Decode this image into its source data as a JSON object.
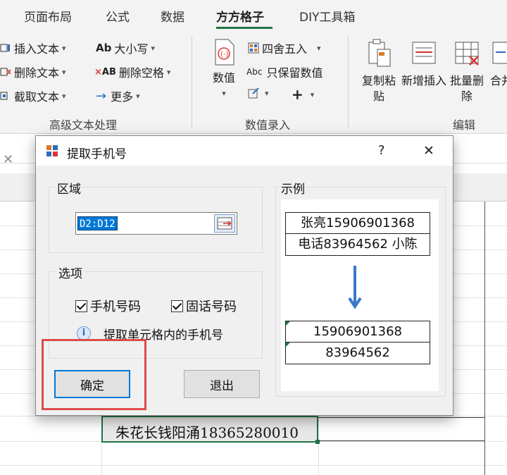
{
  "ribbon": {
    "tabs": [
      "页面布局",
      "公式",
      "数据",
      "方方格子",
      "DIY工具箱"
    ],
    "active_tab": "方方格子",
    "text_group": {
      "items": [
        "插入文本",
        "删除文本",
        "截取文本"
      ],
      "case_label": "大小写",
      "remove_space_label": "删除空格",
      "more_label": "更多",
      "group_label": "高级文本处理"
    },
    "number_group": {
      "value_label": "数值",
      "round_label": "四舍五入",
      "keep_value_label": "只保留数值",
      "group_label": "数值录入"
    },
    "edit_group": {
      "copy_paste_label": "复制粘贴",
      "new_insert_label": "新增插入",
      "batch_delete_label": "批量删除",
      "merge_label": "合并",
      "group_label": "编辑"
    }
  },
  "sheet": {
    "visible_cell_text": "朱花长钱阳涌18365280010"
  },
  "dialog": {
    "title": "提取手机号",
    "help_label": "?",
    "close_label": "✕",
    "region": {
      "label": "区域",
      "value": "D2:D12"
    },
    "options": {
      "label": "选项",
      "mobile_label": "手机号码",
      "mobile_checked": true,
      "landline_label": "固话号码",
      "landline_checked": true,
      "info_text": "提取单元格内的手机号"
    },
    "example": {
      "label": "示例",
      "input_rows": [
        "张亮15906901368",
        "电话83964562 小陈"
      ],
      "output_rows": [
        "15906901368",
        "83964562"
      ]
    },
    "ok_label": "确定",
    "exit_label": "退出"
  },
  "colors": {
    "accent_green": "#217346",
    "highlight_red": "#e04a4a",
    "selection_blue": "#0078d7",
    "arrow_blue": "#3a78c8"
  }
}
